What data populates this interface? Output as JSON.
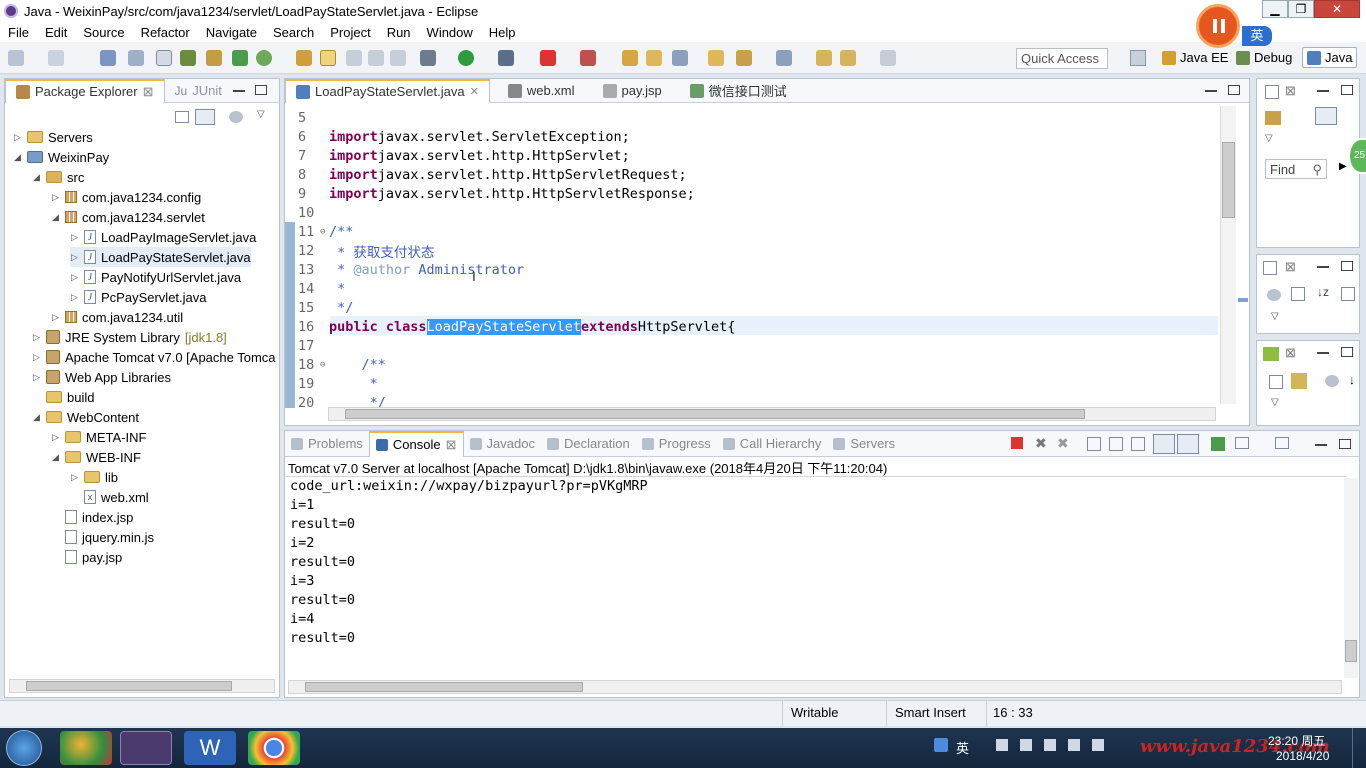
{
  "window": {
    "title": "Java - WeixinPay/src/com/java1234/servlet/LoadPayStateServlet.java - Eclipse",
    "ime": "英"
  },
  "menu": [
    "File",
    "Edit",
    "Source",
    "Refactor",
    "Navigate",
    "Search",
    "Project",
    "Run",
    "Window",
    "Help"
  ],
  "toolbar": {
    "quick_access": "Quick Access",
    "perspectives": [
      "Java EE",
      "Debug",
      "Java"
    ]
  },
  "package_explorer": {
    "tabs": [
      "Package Explorer",
      "JUnit"
    ],
    "items": [
      {
        "label": "Servers",
        "extra": ""
      },
      {
        "label": "WeixinPay",
        "extra": ""
      },
      {
        "label": "src",
        "extra": ""
      },
      {
        "label": "com.java1234.config",
        "extra": ""
      },
      {
        "label": "com.java1234.servlet",
        "extra": ""
      },
      {
        "label": "LoadPayImageServlet.java",
        "extra": ""
      },
      {
        "label": "LoadPayStateServlet.java",
        "extra": ""
      },
      {
        "label": "PayNotifyUrlServlet.java",
        "extra": ""
      },
      {
        "label": "PcPayServlet.java",
        "extra": ""
      },
      {
        "label": "com.java1234.util",
        "extra": ""
      },
      {
        "label": "JRE System Library",
        "extra": "[jdk1.8]"
      },
      {
        "label": "Apache Tomcat v7.0 [Apache Tomca",
        "extra": ""
      },
      {
        "label": "Web App Libraries",
        "extra": ""
      },
      {
        "label": "build",
        "extra": ""
      },
      {
        "label": "WebContent",
        "extra": ""
      },
      {
        "label": "META-INF",
        "extra": ""
      },
      {
        "label": "WEB-INF",
        "extra": ""
      },
      {
        "label": "lib",
        "extra": ""
      },
      {
        "label": "web.xml",
        "extra": ""
      },
      {
        "label": "index.jsp",
        "extra": ""
      },
      {
        "label": "jquery.min.js",
        "extra": ""
      },
      {
        "label": "pay.jsp",
        "extra": ""
      }
    ]
  },
  "editor": {
    "tabs": [
      "LoadPayStateServlet.java",
      "web.xml",
      "pay.jsp",
      "微信接口测试"
    ],
    "lines": [
      {
        "n": "5",
        "parts": []
      },
      {
        "n": "6",
        "parts": [
          [
            "kw",
            "import"
          ],
          [
            "",
            "javax.servlet.ServletException;"
          ]
        ]
      },
      {
        "n": "7",
        "parts": [
          [
            "kw",
            "import"
          ],
          [
            "",
            "javax.servlet.http.HttpServlet;"
          ]
        ]
      },
      {
        "n": "8",
        "parts": [
          [
            "kw",
            "import"
          ],
          [
            "",
            "javax.servlet.http.HttpServletRequest;"
          ]
        ]
      },
      {
        "n": "9",
        "parts": [
          [
            "kw",
            "import"
          ],
          [
            "",
            "javax.servlet.http.HttpServletResponse;"
          ]
        ]
      },
      {
        "n": "10",
        "parts": []
      },
      {
        "n": "11",
        "parts": [
          [
            "cm",
            "/**"
          ]
        ]
      },
      {
        "n": "12",
        "parts": [
          [
            "cm",
            " * 获取支付状态"
          ]
        ]
      },
      {
        "n": "13",
        "parts": [
          [
            "cm",
            " * "
          ],
          [
            "cm2",
            "@author"
          ],
          [
            "cm",
            " Administrator"
          ]
        ]
      },
      {
        "n": "14",
        "parts": [
          [
            "cm",
            " *"
          ]
        ]
      },
      {
        "n": "15",
        "parts": [
          [
            "cm",
            " */"
          ]
        ]
      },
      {
        "n": "16",
        "parts": [
          [
            "kw",
            "public class"
          ],
          [
            "sel",
            "LoadPayStateServlet"
          ],
          [
            "kw",
            "extends"
          ],
          [
            "",
            "HttpServlet{"
          ]
        ]
      },
      {
        "n": "17",
        "parts": []
      },
      {
        "n": "18",
        "parts": [
          [
            "cm",
            "    /**"
          ]
        ]
      },
      {
        "n": "19",
        "parts": [
          [
            "cm",
            "     *"
          ]
        ]
      },
      {
        "n": "20",
        "parts": [
          [
            "cm",
            "     */"
          ]
        ]
      }
    ]
  },
  "right_panels": {
    "find_placeholder": "Find"
  },
  "bottom": {
    "tabs": [
      "Problems",
      "Console",
      "Javadoc",
      "Declaration",
      "Progress",
      "Call Hierarchy",
      "Servers"
    ],
    "console_header": "Tomcat v7.0 Server at localhost [Apache Tomcat] D:\\jdk1.8\\bin\\javaw.exe (2018年4月20日 下午11:20:04)",
    "output": [
      "code_url:weixin://wxpay/bizpayurl?pr=pVKgMRP",
      "i=1",
      "result=0",
      "i=2",
      "result=0",
      "i=3",
      "result=0",
      "i=4",
      "result=0"
    ]
  },
  "status": {
    "writable": "Writable",
    "insert": "Smart Insert",
    "position": "16 : 33"
  },
  "taskbar": {
    "time": "23:20 周五",
    "date": "2018/4/20",
    "ime": "英",
    "watermark": "www.java1234.com",
    "badge": "25"
  }
}
